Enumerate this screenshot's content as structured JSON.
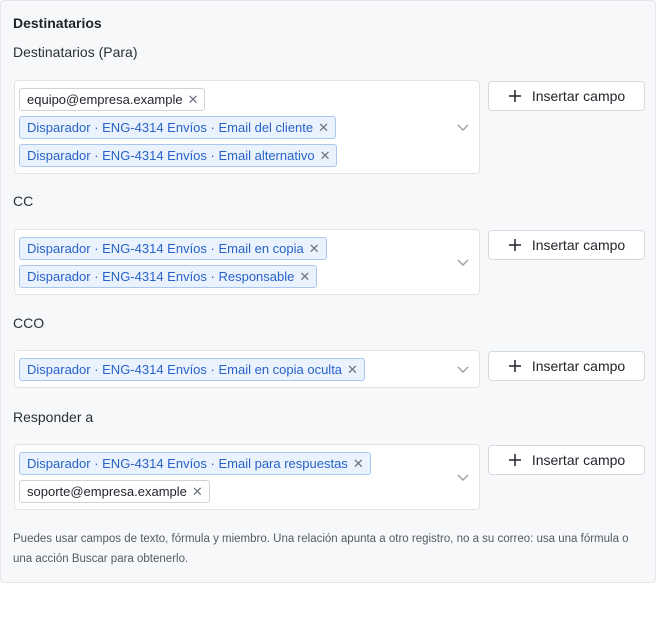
{
  "section": {
    "title": "Destinatarios",
    "insert_label": "Insertar campo",
    "help_text": "Puedes usar campos de texto, fórmula y miembro. Una relación apunta a otro registro, no a su correo: usa una fórmula o una acción Buscar para obtenerlo."
  },
  "groups": [
    {
      "label": "Destinatarios (Para)",
      "tags": [
        {
          "text": "equipo@empresa.example",
          "kind": "plain"
        },
        {
          "text": "Disparador · ENG-4314 Envíos · Email del cliente",
          "kind": "ref"
        },
        {
          "text": "Disparador · ENG-4314 Envíos · Email alternativo",
          "kind": "ref"
        }
      ]
    },
    {
      "label": "CC",
      "tags": [
        {
          "text": "Disparador · ENG-4314 Envíos · Email en copia",
          "kind": "ref"
        },
        {
          "text": "Disparador · ENG-4314 Envíos · Responsable",
          "kind": "ref"
        }
      ]
    },
    {
      "label": "CCO",
      "tags": [
        {
          "text": "Disparador · ENG-4314 Envíos · Email en copia oculta",
          "kind": "ref"
        }
      ]
    },
    {
      "label": "Responder a",
      "tags": [
        {
          "text": "Disparador · ENG-4314 Envíos · Email para respuestas",
          "kind": "ref"
        },
        {
          "text": "soporte@empresa.example",
          "kind": "plain"
        }
      ]
    }
  ]
}
